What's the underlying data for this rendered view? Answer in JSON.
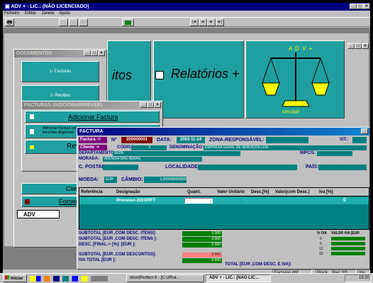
{
  "app": {
    "title": "ADV + - LIC.: (NÃO LICENCIADO)"
  },
  "menu": [
    "Ficheiro",
    "Editar",
    "Janela",
    "Ajuda"
  ],
  "nav": [
    "|◄",
    "◄",
    "►",
    "►|"
  ],
  "panels": {
    "left_text": "itos",
    "relatorios": "Relatórios +",
    "logo_text": "A D V +",
    "logo_sub": "APKOMP"
  },
  "documentos": {
    "title": "DOCUMENTOS",
    "buttons": [
      "1- Facturas",
      "2- Recibos"
    ],
    "tab": "ADV",
    "sub_buttons": [
      "Clientes",
      "Fornecedo"
    ]
  },
  "facturas_menu": {
    "title": "FACTURAS (ADICIONAR/REVER)",
    "items": [
      "Adicionar Factura",
      "Adicionar Factura com todos os itens/das diligências",
      "Rever F",
      "E"
    ]
  },
  "factura": {
    "title": "FACTURA",
    "type": "Factura ->",
    "n_label": "Nº",
    "number": "200000001",
    "data_label": "DATA:",
    "date": "2003-11-24",
    "zona_label": "ZONA-RESPONSÁVEL:",
    "sit_label": "SIT.:",
    "cliente_label": "Cliente ->",
    "codigo_label": "CÓDIGO:",
    "codigo": "5",
    "denominacao_label": "DENOMINAÇÃO:",
    "denominacao": "EMPRESA GERAL DE SERVIÇOS LDA",
    "departamento_label": "DEPARTAMENTO:",
    "departamento": "SEDE",
    "nipc_label": "NIPC/S:",
    "morada_label": "MORADA:",
    "morada": "AVENIDA DAS INDIAS",
    "cpostal_label": "C. POSTAL:",
    "localidade_label": "LOCALIDADE:",
    "pais_label": "PAÍS:",
    "moeda_label": "MOEDA:",
    "moeda": "EUR",
    "cambio_label": "CÂMBIO:",
    "cambio": "1,000000000000",
    "columns": [
      "Referência",
      "Designação",
      "Quant.",
      "Valor Unitário",
      "Desc.[%]",
      "Valor(com Desc.)",
      "Iva [%]"
    ],
    "row": {
      "designacao": "Processo 2003/RFT",
      "quant": ".",
      "valor": ".",
      "valor_desc": ".",
      "iva": "0"
    },
    "totals": [
      {
        "label": "SUBTOTAL [EUR   ,COM DESC. ITENS]:",
        "value": "0.000"
      },
      {
        "label": "SUBTOTAL [EUR   ,COM DESC. ITENS ]:",
        "value": "0.000"
      },
      {
        "label": "DESC. [FINAL-> [%]:              [EUR  ]:",
        "value": "0.000"
      },
      {
        "label": "SUBTOTAL [EUR   ,COM DESCONTOS]:",
        "value": "0.000"
      },
      {
        "label": "IVA TOTAL [EUR   ]:",
        "value": "0.000"
      }
    ],
    "iva_table": {
      "headers": [
        "% IVA",
        "VALOR IVA [EUR"
      ],
      "rates": [
        "0",
        "5",
        "12",
        "19"
      ]
    },
    "total_label": "TOTAL [EUR   ,COM DESC. E IVA]:"
  },
  "status": {
    "file": "Facturas.dbf",
    "rlock": "Rlock",
    "rec": "Rec 3/3",
    "ins": "Ins"
  },
  "taskbar": {
    "start": "Iniciar",
    "tasks": [
      "WordPerfect 9 - [C:\\3Rui...",
      "ADV + - LIC.: (NÃO LIC..."
    ],
    "clock": "19:20"
  }
}
